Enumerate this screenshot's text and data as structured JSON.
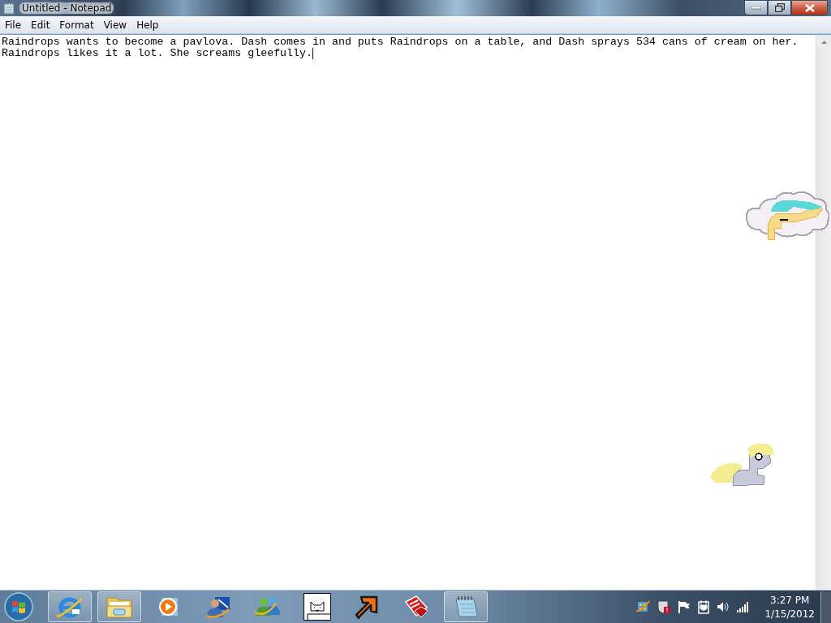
{
  "window": {
    "title": "Untitled - Notepad"
  },
  "menu": [
    "File",
    "Edit",
    "Format",
    "View",
    "Help"
  ],
  "editor": {
    "lines": [
      "Raindrops wants to become a pavlova. Dash comes in and puts Raindrops on a table, and Dash sprays 534 cans of cream on her.",
      "Raindrops likes it a lot. She screams gleefully."
    ]
  },
  "taskbar": {
    "apps": [
      {
        "kind": "browser",
        "running": true
      },
      {
        "kind": "folder",
        "running": true
      },
      {
        "kind": "media",
        "running": false
      },
      {
        "kind": "remote",
        "running": false
      },
      {
        "kind": "messenger",
        "running": false
      },
      {
        "kind": "cat",
        "running": false
      },
      {
        "kind": "arrow",
        "running": false
      },
      {
        "kind": "cards",
        "running": false
      },
      {
        "kind": "notepad",
        "running": true
      }
    ],
    "clock": {
      "time": "3:27 PM",
      "date": "1/15/2012"
    }
  }
}
